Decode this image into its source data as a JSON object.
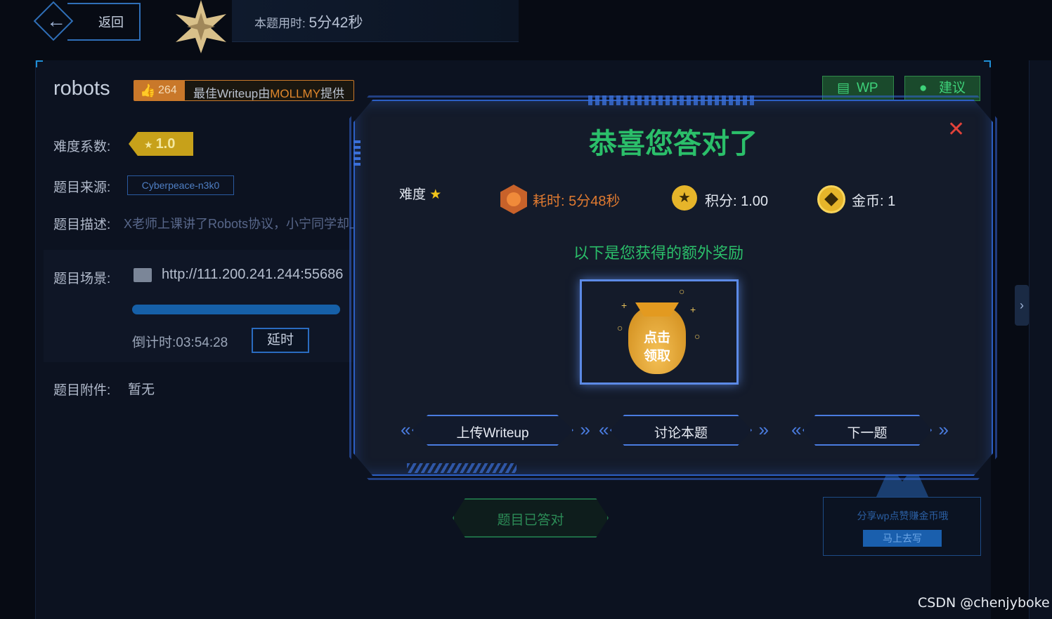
{
  "topbar": {
    "back_label": "返回",
    "time_label": "本题用时: ",
    "time_value": "5分42秒"
  },
  "problem": {
    "title": "robots",
    "likes": "264",
    "best_writeup_prefix": "最佳Writeup由",
    "best_writeup_author": "MOLLMY",
    "best_writeup_suffix": "提供",
    "difficulty_label": "难度系数:",
    "difficulty_value": "1.0",
    "source_label": "题目来源:",
    "source_value": "Cyberpeace-n3k0",
    "desc_label": "题目描述:",
    "desc_value": "X老师上课讲了Robots协议，小宁同学却上",
    "scene_label": "题目场景:",
    "scene_url": "http://111.200.241.244:55686",
    "scene_progress": 1.0,
    "countdown_label": "倒计时:",
    "countdown_value": "03:54:28",
    "delay_label": "延时",
    "attach_label": "题目附件:",
    "attach_value": "暂无",
    "wp_label": "WP",
    "suggest_label": "建议",
    "answered_label": "题目已答对"
  },
  "share": {
    "text": "分享wp点赞赚金币哦",
    "button": "马上去写"
  },
  "modal": {
    "title": "恭喜您答对了",
    "difficulty_label": "难度",
    "time_label": "耗时: 5分48秒",
    "score_label": "积分: 1.00",
    "coin_label": "金币: 1",
    "bonus_text": "以下是您获得的额外奖励",
    "gift_line1": "点击",
    "gift_line2": "领取",
    "buttons": [
      "上传Writeup",
      "讨论本题",
      "下一题"
    ]
  },
  "watermark": "CSDN @chenjyboke",
  "colors": {
    "accent_green": "#2bbf6a",
    "accent_blue": "#2c5fc4",
    "accent_orange": "#e07a30",
    "gold": "#e6b52a"
  }
}
